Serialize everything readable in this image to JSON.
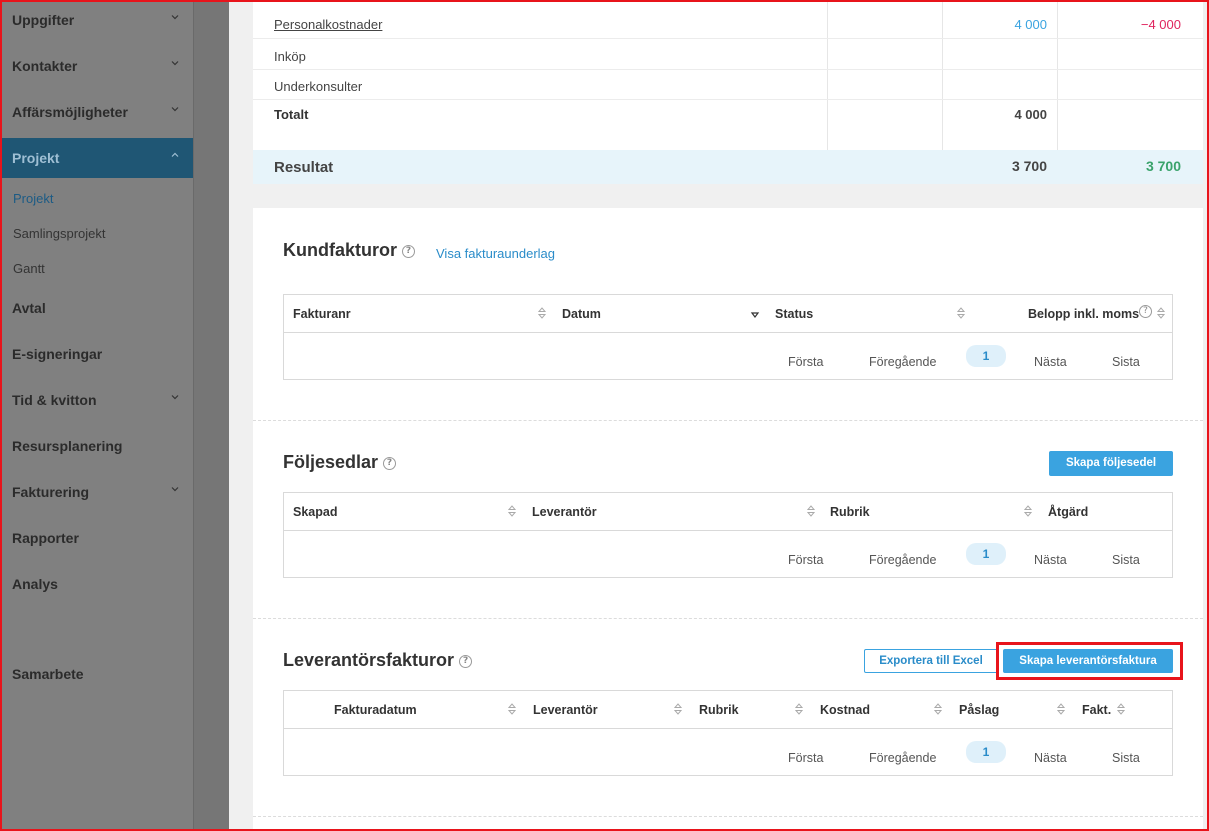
{
  "sidebar": {
    "items": [
      {
        "label": "Uppgifter",
        "chevron": "down"
      },
      {
        "label": "Kontakter",
        "chevron": "down"
      },
      {
        "label": "Affärsmöjligheter",
        "chevron": "down"
      },
      {
        "label": "Projekt",
        "chevron": "up",
        "active": true
      },
      {
        "label": "Avtal"
      },
      {
        "label": "E-signeringar"
      },
      {
        "label": "Tid & kvitton",
        "chevron": "down"
      },
      {
        "label": "Resursplanering"
      },
      {
        "label": "Fakturering",
        "chevron": "down"
      },
      {
        "label": "Rapporter"
      },
      {
        "label": "Analys"
      },
      {
        "label": "Samarbete"
      }
    ],
    "subitems": [
      {
        "label": "Projekt",
        "active": true
      },
      {
        "label": "Samlingsprojekt"
      },
      {
        "label": "Gantt"
      }
    ]
  },
  "cost_table": {
    "rows": [
      {
        "label": "Personalkostnader",
        "col3": "4 000",
        "col4": "−4 000"
      },
      {
        "label": "Inköp"
      },
      {
        "label": "Underkonsulter"
      }
    ],
    "total_label": "Totalt",
    "total_col3": "4 000",
    "result_label": "Resultat",
    "result_col3": "3 700",
    "result_col4": "3 700"
  },
  "kundfakturor": {
    "title": "Kundfakturor",
    "link": "Visa fakturaunderlag",
    "columns": [
      "Fakturanr",
      "Datum",
      "Status",
      "Belopp inkl. moms"
    ]
  },
  "foljesedlar": {
    "title": "Följesedlar",
    "button": "Skapa följesedel",
    "columns": [
      "Skapad",
      "Leverantör",
      "Rubrik",
      "Åtgärd"
    ]
  },
  "leverantorsfakturor": {
    "title": "Leverantörsfakturor",
    "export_button": "Exportera till Excel",
    "create_button": "Skapa leverantörsfaktura",
    "columns": [
      "Fakturadatum",
      "Leverantör",
      "Rubrik",
      "Kostnad",
      "Påslag",
      "Fakt."
    ]
  },
  "pager": {
    "first": "Första",
    "prev": "Föregående",
    "current": "1",
    "next": "Nästa",
    "last": "Sista"
  },
  "colors": {
    "accent": "#3aa3e0",
    "negative": "#e0245e",
    "positive": "#3aa36b",
    "highlight": "#e8141b"
  },
  "icons": [
    "chevron-down-icon",
    "chevron-up-icon",
    "sort-icon",
    "sort-desc-icon",
    "help-icon"
  ]
}
